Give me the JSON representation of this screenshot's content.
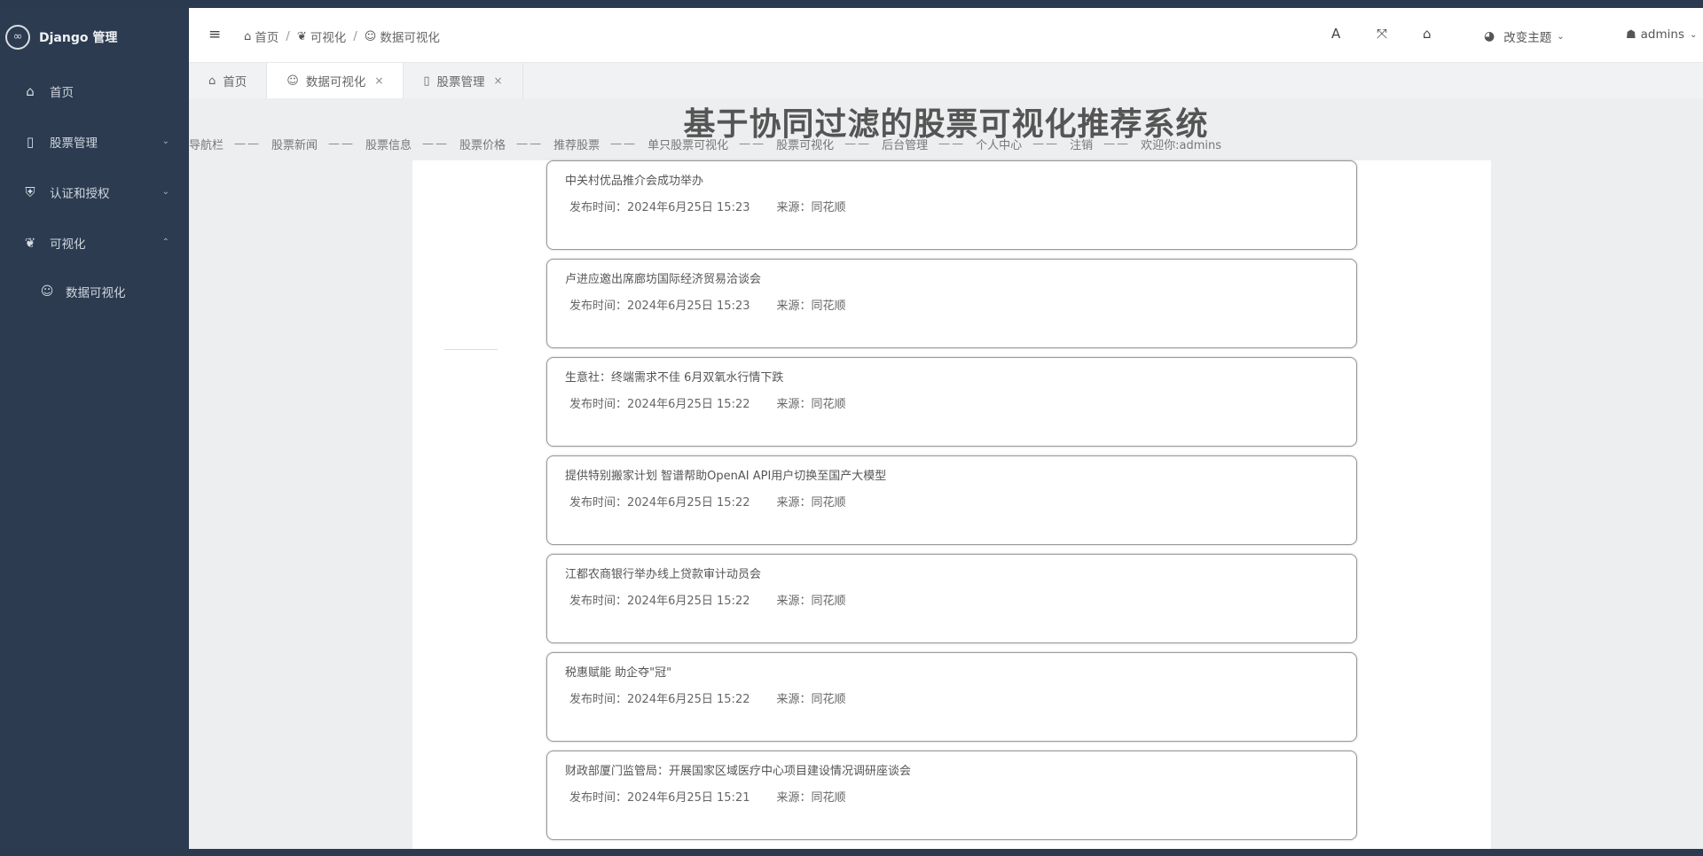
{
  "app": {
    "logo_text": "Django 管理"
  },
  "sidebar": {
    "items": [
      {
        "label": "首页",
        "icon": "home-icon",
        "caret": ""
      },
      {
        "label": "股票管理",
        "icon": "document-icon",
        "caret": "⌄"
      },
      {
        "label": "认证和授权",
        "icon": "shield-icon",
        "caret": "⌄"
      },
      {
        "label": "可视化",
        "icon": "leaf-icon",
        "caret": "⌃"
      }
    ],
    "subitems": [
      {
        "label": "数据可视化",
        "icon": "smile-icon"
      }
    ]
  },
  "header": {
    "breadcrumb": [
      "首页",
      "可视化",
      "数据可视化"
    ],
    "theme_label": "改变主题",
    "user_label": "admins",
    "tools": [
      "font-size-icon",
      "fullscreen-icon",
      "home-icon"
    ]
  },
  "tabs": [
    {
      "label": "首页",
      "icon": "home-icon",
      "closable": false
    },
    {
      "label": "数据可视化",
      "icon": "smile-icon",
      "closable": true,
      "active": true
    },
    {
      "label": "股票管理",
      "icon": "document-icon",
      "closable": true
    }
  ],
  "site": {
    "title": "基于协同过滤的股票可视化推荐系统",
    "nav": [
      "导航栏",
      "股票新闻",
      "股票信息",
      "股票价格",
      "推荐股票",
      "单只股票可视化",
      "股票可视化",
      "后台管理",
      "个人中心",
      "注销",
      "欢迎你:admins"
    ],
    "nav_separator": "——"
  },
  "news": [
    {
      "title": "中关村优品推介会成功举办",
      "time_label": "发布时间：2024年6月25日 15:23",
      "source_label": "来源：同花顺"
    },
    {
      "title": "卢进应邀出席廊坊国际经济贸易洽谈会",
      "time_label": "发布时间：2024年6月25日 15:23",
      "source_label": "来源：同花顺"
    },
    {
      "title": "生意社：终端需求不佳 6月双氧水行情下跌",
      "time_label": "发布时间：2024年6月25日 15:22",
      "source_label": "来源：同花顺"
    },
    {
      "title": "提供特别搬家计划 智谱帮助OpenAI API用户切换至国产大模型",
      "time_label": "发布时间：2024年6月25日 15:22",
      "source_label": "来源：同花顺"
    },
    {
      "title": "江都农商银行举办线上贷款审计动员会",
      "time_label": "发布时间：2024年6月25日 15:22",
      "source_label": "来源：同花顺"
    },
    {
      "title": "税惠赋能 助企夺\"冠\"",
      "time_label": "发布时间：2024年6月25日 15:22",
      "source_label": "来源：同花顺"
    },
    {
      "title": "财政部厦门监管局：开展国家区域医疗中心项目建设情况调研座谈会",
      "time_label": "发布时间：2024年6月25日 15:21",
      "source_label": "来源：同花顺"
    }
  ],
  "colors": {
    "sidebar_bg": "#2c3b50",
    "header_bg": "#ffffff",
    "content_bg": "#eceeef"
  }
}
